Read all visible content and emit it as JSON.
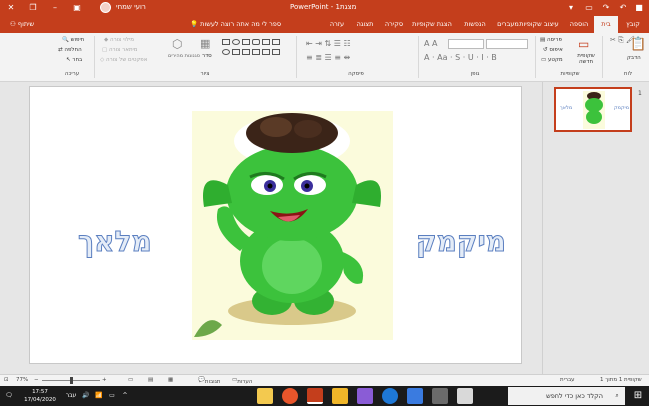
{
  "window": {
    "title": "PowerPoint - מצגת1",
    "user": "רועי שמחי",
    "controls": [
      "close",
      "maximize",
      "minimize",
      "ribbon-display"
    ],
    "quick_access": [
      "save",
      "undo",
      "redo",
      "start-from-beginning",
      "customize"
    ]
  },
  "tabs": [
    "קובץ",
    "בית",
    "הוספה",
    "עיצוב שקופיות",
    "מעברים",
    "הנפשות",
    "הצגת שקופיות",
    "סקירה",
    "תצוגה",
    "עזרה"
  ],
  "active_tab": "בית",
  "tellme": "ספר לי מה אתה רוצה לעשות",
  "share_label": "שיתוף",
  "ribbon": {
    "groups": [
      "לוח",
      "שקופיות",
      "גופן",
      "פיסקה",
      "ציור",
      "עריכה"
    ],
    "clipboard": {
      "paste": "הדבק"
    },
    "slides": {
      "new_slide": "שקופית חדשה",
      "layout": "פריסה",
      "reset": "איפוס",
      "section": "מקטע"
    },
    "drawing": {
      "arrange": "סדר",
      "quick_styles": "סגנונות מהירים",
      "fill": "מילוי צורה",
      "outline": "מיתאר צורה",
      "effects": "אפקטים של צורה"
    },
    "editing": {
      "find": "חיפוש",
      "replace": "החלפה",
      "select": "בחר"
    }
  },
  "slide": {
    "left_text": "מלאך",
    "right_text": "מיקמק"
  },
  "thumbnail": {
    "number": "1",
    "left_text": "מלאך",
    "right_text": "מיקמק"
  },
  "status": {
    "slide_info": "שקופית 1 מתוך 1",
    "language": "עברית",
    "notes": "הערות",
    "comments": "תגובות",
    "zoom": "77%"
  },
  "taskbar": {
    "search_placeholder": "הקלד כאן כדי לחפש",
    "time": "17:57",
    "date": "17/04/2020",
    "language": "עבר"
  }
}
